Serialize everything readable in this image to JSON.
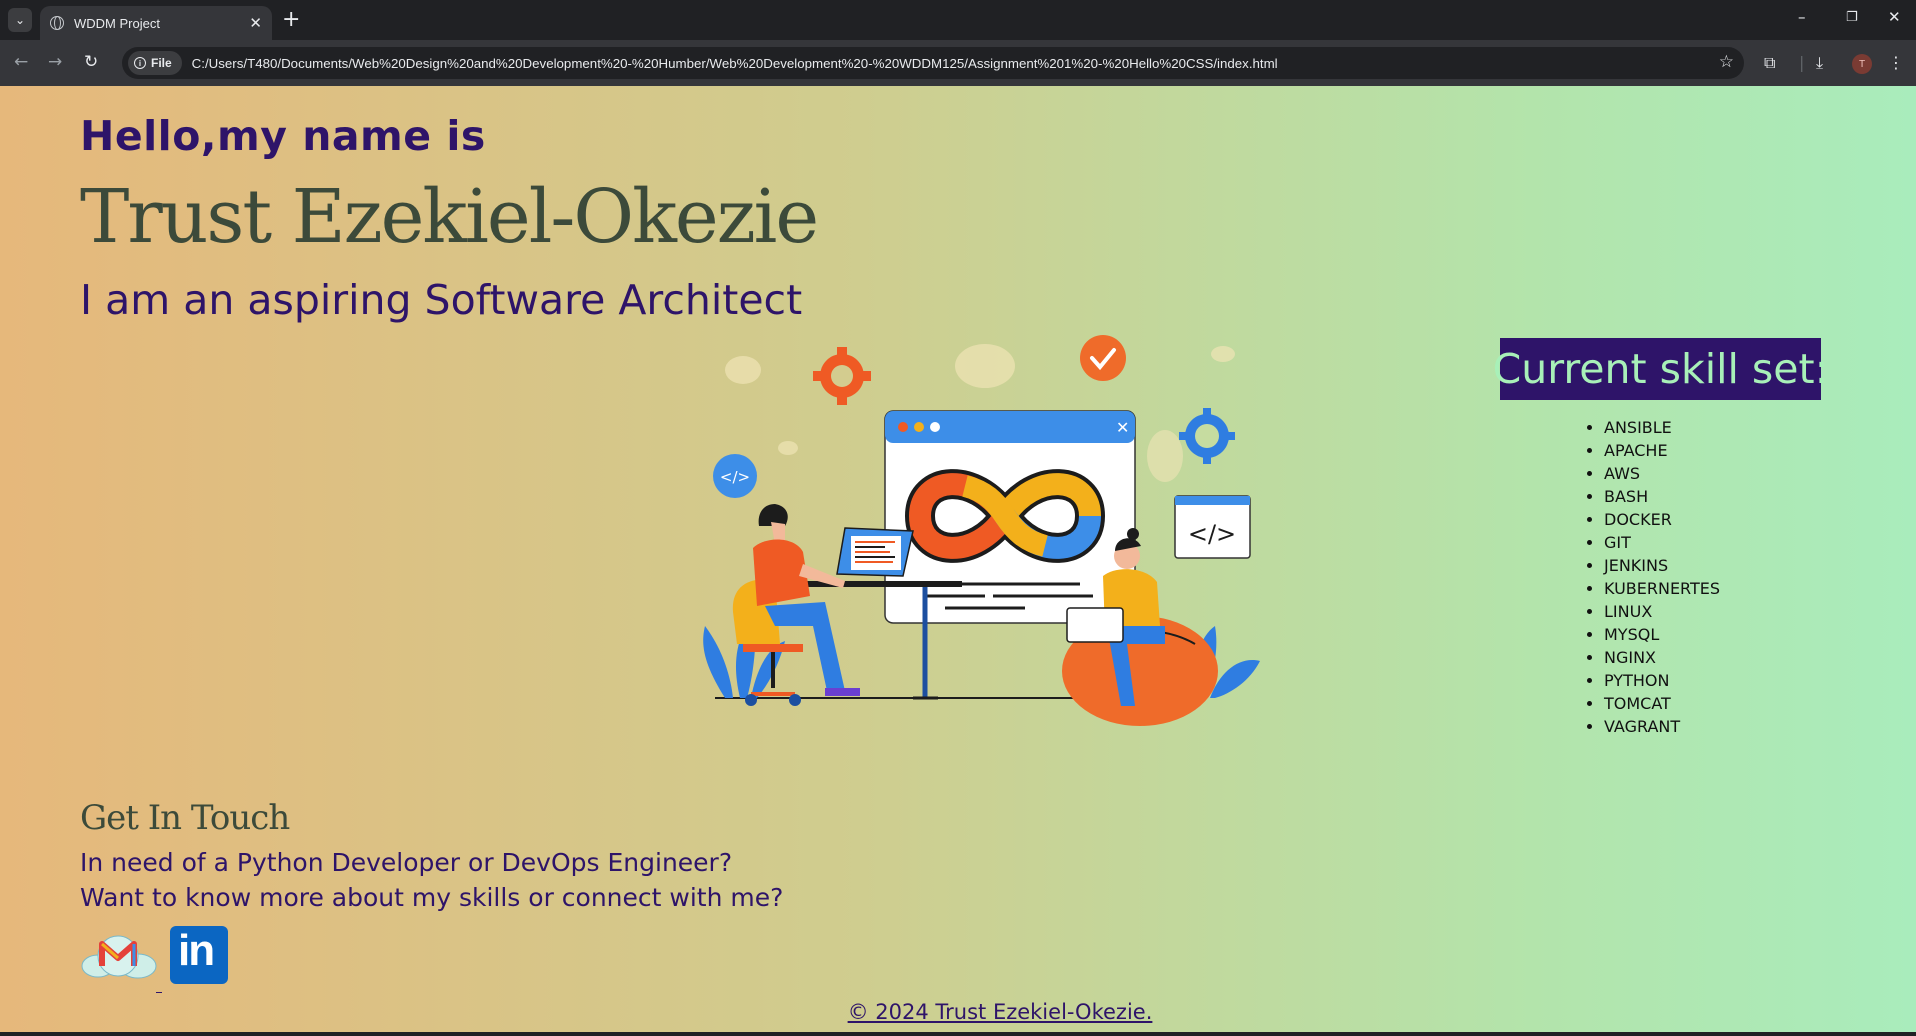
{
  "browser": {
    "tab_title": "WDDM Project",
    "new_tab": "+",
    "tab_close": "✕",
    "chip_label": "File",
    "url": "C:/Users/T480/Documents/Web%20Design%20and%20Development%20-%20Humber/Web%20Development%20-%20WDDM125/Assignment%201%20-%20Hello%20CSS/index.html",
    "profile_initial": "T",
    "window_controls": {
      "minimize": "–",
      "restore": "❐",
      "close": "✕"
    }
  },
  "header": {
    "hello": "Hello,my name is",
    "name": "Trust Ezekiel-Okezie",
    "tagline": "I am an aspiring Software Architect"
  },
  "skills": {
    "title": "Current skill set:",
    "items": [
      "ANSIBLE",
      "APACHE",
      "AWS",
      "BASH",
      "DOCKER",
      "GIT",
      "JENKINS",
      "KUBERNERTES",
      "LINUX",
      "MYSQL",
      "NGINX",
      "PYTHON",
      "TOMCAT",
      "VAGRANT"
    ]
  },
  "contact": {
    "heading": "Get In Touch",
    "line1": "In need of a Python Developer or DevOps Engineer?",
    "line2": "Want to know more about my skills or connect with me?",
    "linkedin_text": "in"
  },
  "footer": {
    "copyright": "© 2024 Trust Ezekiel-Okezie."
  },
  "colors": {
    "accent_purple": "#2e1469",
    "skill_title_text": "#a8f0b8",
    "linkedin_blue": "#0b66c2"
  }
}
